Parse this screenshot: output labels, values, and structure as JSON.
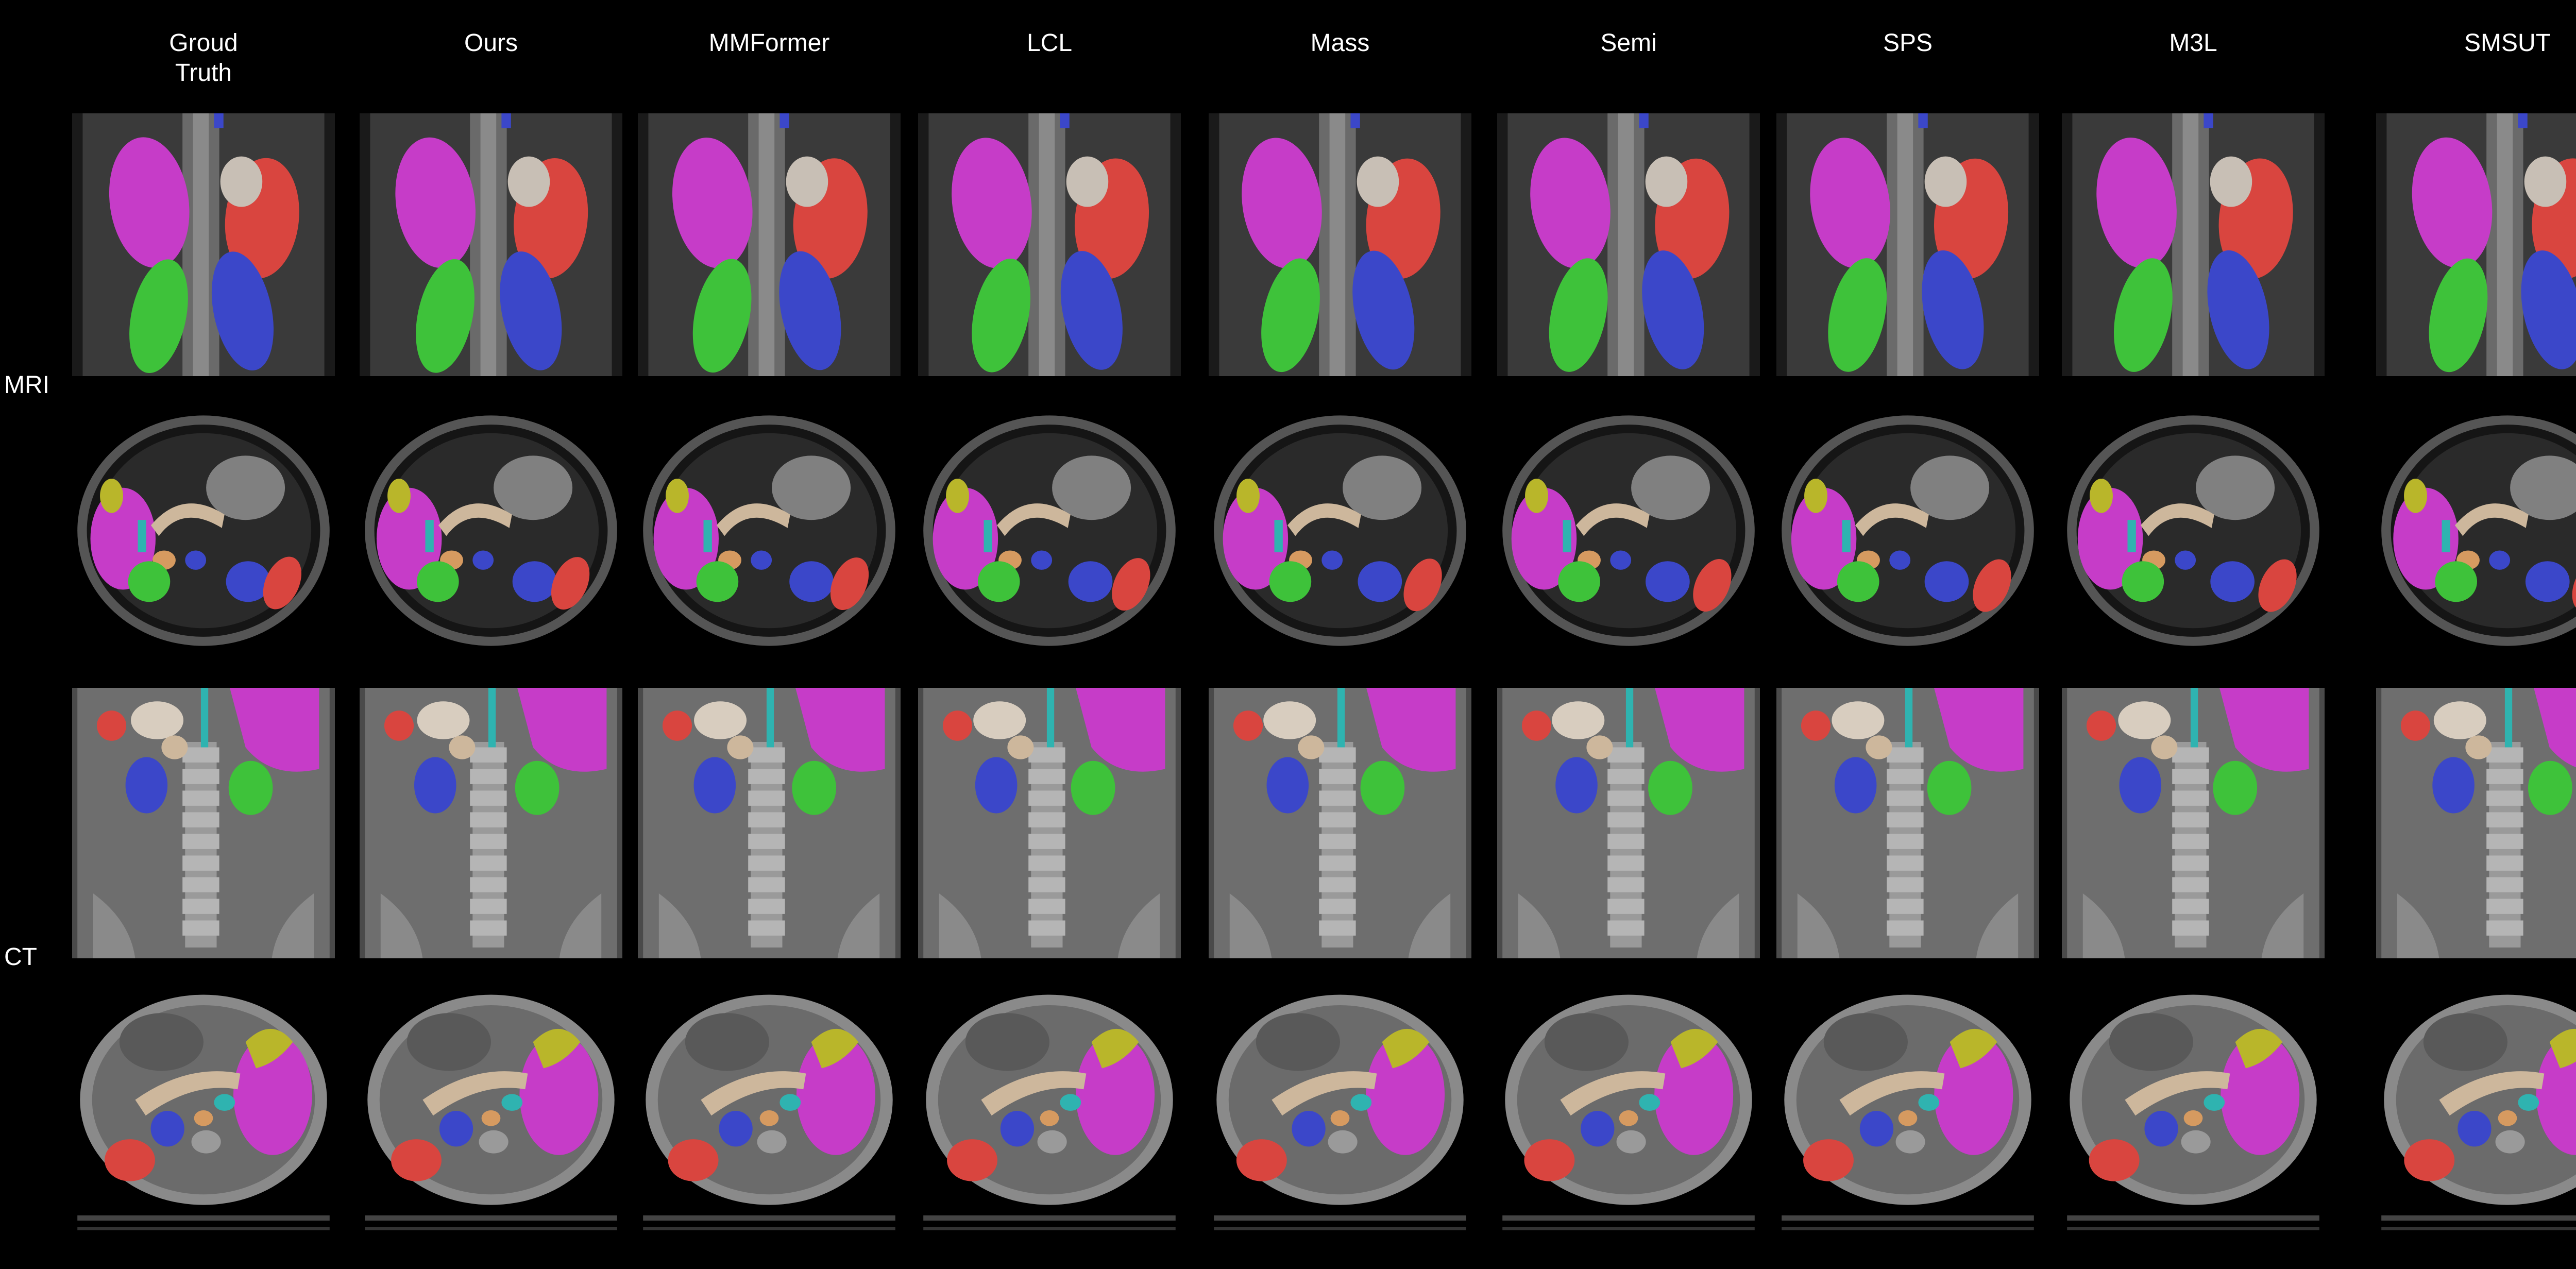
{
  "columns": [
    {
      "key": "gt",
      "label": "Groud\nTruth"
    },
    {
      "key": "ours",
      "label": "Ours"
    },
    {
      "key": "mmformer",
      "label": "MMFormer"
    },
    {
      "key": "lcl",
      "label": "LCL"
    },
    {
      "key": "mass",
      "label": "Mass"
    },
    {
      "key": "semi",
      "label": "Semi"
    },
    {
      "key": "sps",
      "label": "SPS"
    },
    {
      "key": "m3l",
      "label": "M3L"
    },
    {
      "key": "smsut",
      "label": "SMSUT"
    }
  ],
  "row_labels": {
    "mri": "MRI",
    "ct": "CT"
  },
  "rows": [
    {
      "modality": "mri",
      "view": "coronal"
    },
    {
      "modality": "mri",
      "view": "axial"
    },
    {
      "modality": "ct",
      "view": "coronal"
    },
    {
      "modality": "ct",
      "view": "axial"
    }
  ],
  "organ_colors": {
    "liver": "#c63cc8",
    "spleen": "#d9453f",
    "right_kidney": "#3ec23a",
    "left_kidney": "#3b47c9",
    "gallbladder": "#b9b62a",
    "pancreas": "#cdb79c",
    "aorta": "#d69a60",
    "ivc": "#2fb3b0",
    "stomach": "#d8cdbf"
  }
}
